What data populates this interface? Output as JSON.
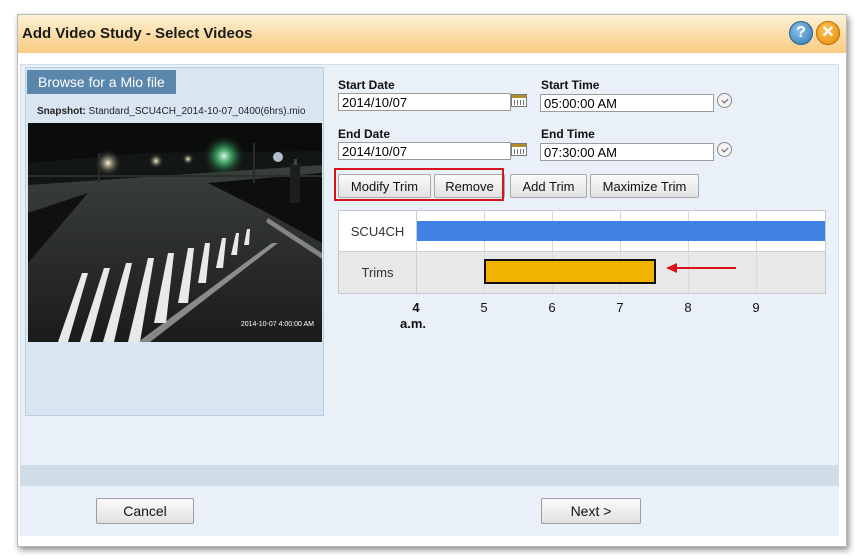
{
  "dialog": {
    "title": "Add Video Study - Select Videos",
    "help_icon_glyph": "?",
    "close_icon_glyph": "✕"
  },
  "left_panel": {
    "browse_label": "Browse for a Mio file",
    "snapshot_prefix": "Snapshot:",
    "snapshot_filename": "Standard_SCU4CH_2014-10-07_0400(6hrs).mio",
    "video_timestamp": "2014-10-07 4:00:00 AM"
  },
  "fields": {
    "start_date_label": "Start Date",
    "start_date_value": "2014/10/07",
    "start_time_label": "Start Time",
    "start_time_value": "05:00:00 AM",
    "end_date_label": "End Date",
    "end_date_value": "2014/10/07",
    "end_time_label": "End Time",
    "end_time_value": "07:30:00 AM"
  },
  "toolbar": {
    "modify_trim": "Modify Trim",
    "remove": "Remove",
    "add_trim": "Add Trim",
    "maximize_trim": "Maximize Trim"
  },
  "timeline": {
    "rows": [
      "SCU4CH",
      "Trims"
    ],
    "ticks": [
      "4",
      "5",
      "6",
      "7",
      "8",
      "9"
    ],
    "first_tick_suffix": "a.m.",
    "colors": {
      "video": "#3f82e4",
      "trim": "#f1b300",
      "arrow": "#d6141e"
    }
  },
  "footer": {
    "cancel": "Cancel",
    "next": "Next >"
  }
}
